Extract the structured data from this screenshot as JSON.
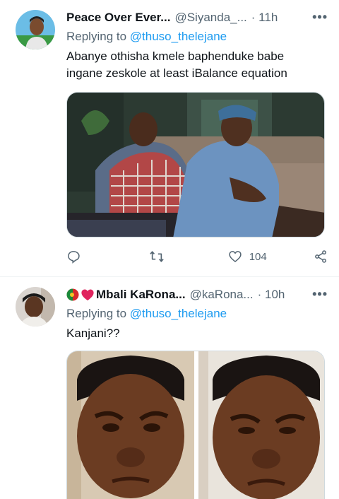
{
  "tweets": [
    {
      "name": "Peace Over Ever...",
      "handle": "@Siyanda_...",
      "time": "· 11h",
      "more": "•••",
      "reply_prefix": "Replying to",
      "reply_to": "@thuso_thelejane",
      "text": "Abanye othisha kmele baphenduke babe ingane zeskole at least iBalance equation",
      "media": "photo-two-people-on-couch",
      "actions": {
        "reply_count": "",
        "retweet_count": "",
        "like_count": "104"
      }
    },
    {
      "name": "Mbali KaRona...",
      "name_emoji": [
        "portugal-flag",
        "red-heart"
      ],
      "handle": "@kaRona...",
      "time": "· 10h",
      "more": "•••",
      "reply_prefix": "Replying to",
      "reply_to": "@thuso_thelejane",
      "text": "Kanjani??",
      "media": "photo-child-frowning-side-by-side"
    }
  ],
  "colors": {
    "accent": "#1d9bf0",
    "secondary_text": "#536471",
    "primary_text": "#0f1419",
    "divider": "#eff3f4"
  }
}
